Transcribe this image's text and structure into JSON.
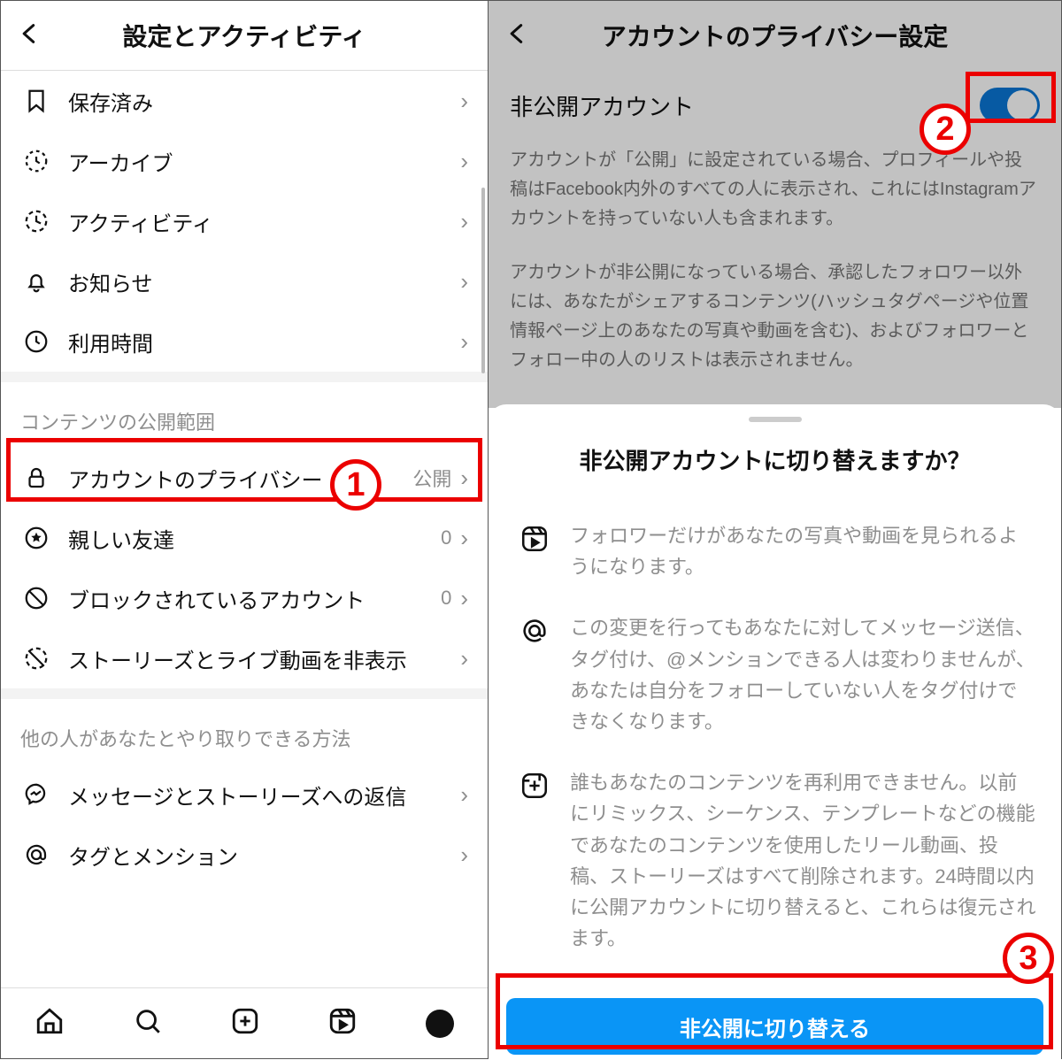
{
  "left": {
    "header_title": "設定とアクティビティ",
    "rows": [
      {
        "label": "保存済み"
      },
      {
        "label": "アーカイブ"
      },
      {
        "label": "アクティビティ"
      },
      {
        "label": "お知らせ"
      },
      {
        "label": "利用時間"
      }
    ],
    "section1_title": "コンテンツの公開範囲",
    "privacy": {
      "label": "アカウントのプライバシー",
      "value": "公開"
    },
    "close_friends": {
      "label": "親しい友達",
      "value": "0"
    },
    "blocked": {
      "label": "ブロックされているアカウント",
      "value": "0"
    },
    "hide_story": {
      "label": "ストーリーズとライブ動画を非表示"
    },
    "section2_title": "他の人があなたとやり取りできる方法",
    "msg_replies": {
      "label": "メッセージとストーリーズへの返信"
    },
    "tags": {
      "label": "タグとメンション"
    }
  },
  "right": {
    "header_title": "アカウントのプライバシー設定",
    "toggle_label": "非公開アカウント",
    "desc1": "アカウントが「公開」に設定されている場合、プロフィールや投稿はFacebook内外のすべての人に表示され、これにはInstagramアカウントを持っていない人も含まれます。",
    "desc2": "アカウントが非公開になっている場合、承認したフォロワー以外には、あなたがシェアするコンテンツ(ハッシュタグページや位置情報ページ上のあなたの写真や動画を含む)、およびフォロワーとフォロー中の人のリストは表示されません。",
    "sheet_title": "非公開アカウントに切り替えますか？",
    "info1": "フォロワーだけがあなたの写真や動画を見られるようになります。",
    "info2": "この変更を行ってもあなたに対してメッセージ送信、タグ付け、@メンションできる人は変わりませんが、あなたは自分をフォローしていない人をタグ付けできなくなります。",
    "info3": "誰もあなたのコンテンツを再利用できません。以前にリミックス、シーケンス、テンプレートなどの機能であなたのコンテンツを使用したリール動画、投稿、ストーリーズはすべて削除されます。24時間以内に公開アカウントに切り替えると、これらは復元されます。",
    "cta": "非公開に切り替える"
  },
  "badges": {
    "b1": "1",
    "b2": "2",
    "b3": "3"
  }
}
